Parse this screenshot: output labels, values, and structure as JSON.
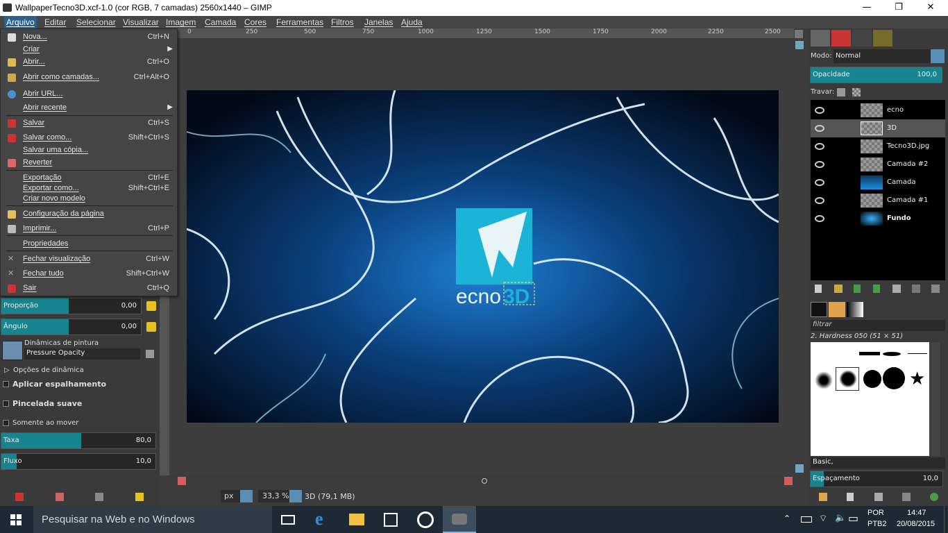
{
  "window": {
    "title": "WallpaperTecno3D.xcf-1.0 (cor RGB, 7 camadas) 2560x1440 – GIMP",
    "min": "—",
    "max": "❐",
    "close": "✕"
  },
  "menubar": [
    "Arquivo",
    "Editar",
    "Selecionar",
    "Visualizar",
    "Imagem",
    "Camada",
    "Cores",
    "Ferramentas",
    "Filtros",
    "Janelas",
    "Ajuda"
  ],
  "file_menu": [
    {
      "label": "Nova...",
      "shortcut": "Ctrl+N"
    },
    {
      "label": "Criar",
      "shortcut": ""
    },
    {
      "label": "Abrir...",
      "shortcut": "Ctrl+O"
    },
    {
      "label": "Abrir como camadas...",
      "shortcut": "Ctrl+Alt+O"
    },
    {
      "label": "Abrir URL...",
      "shortcut": ""
    },
    {
      "label": "Abrir recente",
      "shortcut": ""
    },
    {
      "label": "Salvar",
      "shortcut": "Ctrl+S"
    },
    {
      "label": "Salvar como...",
      "shortcut": "Shift+Ctrl+S"
    },
    {
      "label": "Salvar uma cópia...",
      "shortcut": ""
    },
    {
      "label": "Reverter",
      "shortcut": ""
    },
    {
      "label": "Exportação",
      "shortcut": "Ctrl+E"
    },
    {
      "label": "Exportar como...",
      "shortcut": "Shift+Ctrl+E"
    },
    {
      "label": "Criar novo modelo",
      "shortcut": ""
    },
    {
      "label": "Configuração da página",
      "shortcut": ""
    },
    {
      "label": "Imprimir...",
      "shortcut": "Ctrl+P"
    },
    {
      "label": "Propriedades",
      "shortcut": ""
    },
    {
      "label": "Fechar visualização",
      "shortcut": "Ctrl+W"
    },
    {
      "label": "Fechar tudo",
      "shortcut": "Shift+Ctrl+W"
    },
    {
      "label": "Sair",
      "shortcut": "Ctrl+Q"
    }
  ],
  "tool_options": {
    "proporcao_label": "Proporção",
    "proporcao_value": "0,00",
    "angulo_label": "Ângulo",
    "angulo_value": "0,00",
    "dynamics_label": "Dinâmicas de pintura",
    "dynamics_value": "Pressure Opacity",
    "dynamics_options": "Opções de dinâmica",
    "apply_jitter": "Aplicar espalhamento",
    "smooth": "Pincelada suave",
    "only_move": "Somente ao mover",
    "taxa_label": "Taxa",
    "taxa_value": "80,0",
    "taxa_fraction": 0.8,
    "fluxo_label": "Fluxo",
    "fluxo_value": "10,0",
    "fluxo_fraction": 0.1
  },
  "ruler_labels": [
    "0",
    "250",
    "500",
    "750",
    "1000",
    "1250",
    "1500",
    "1750",
    "2000",
    "2250",
    "2500"
  ],
  "image_text": {
    "ecno": "ecno",
    "three_d": "3D"
  },
  "statusbar": {
    "unit": "px",
    "zoom": "33,3 %",
    "layer_info": "3D (79,1 MB)"
  },
  "layers_panel": {
    "mode_label": "Modo:",
    "mode_value": "Normal",
    "opacity_label": "Opacidade",
    "opacity_value": "100,0",
    "lock_label": "Travar:",
    "layers": [
      "ecno",
      "3D",
      "Tecno3D.jpg",
      "Camada #2",
      "Camada",
      "Camada #1",
      "Fundo"
    ]
  },
  "brushes_panel": {
    "filter_placeholder": "filtrar",
    "brush_name": "2. Hardness 050 (51 × 51)",
    "preset": "Basic,",
    "spacing_label": "Espaçamento",
    "spacing_value": "10,0"
  },
  "taskbar": {
    "search_placeholder": "Pesquisar na Web e no Windows",
    "lang1": "POR",
    "lang2": "PTB2",
    "time": "14:47",
    "date": "20/08/2015"
  }
}
